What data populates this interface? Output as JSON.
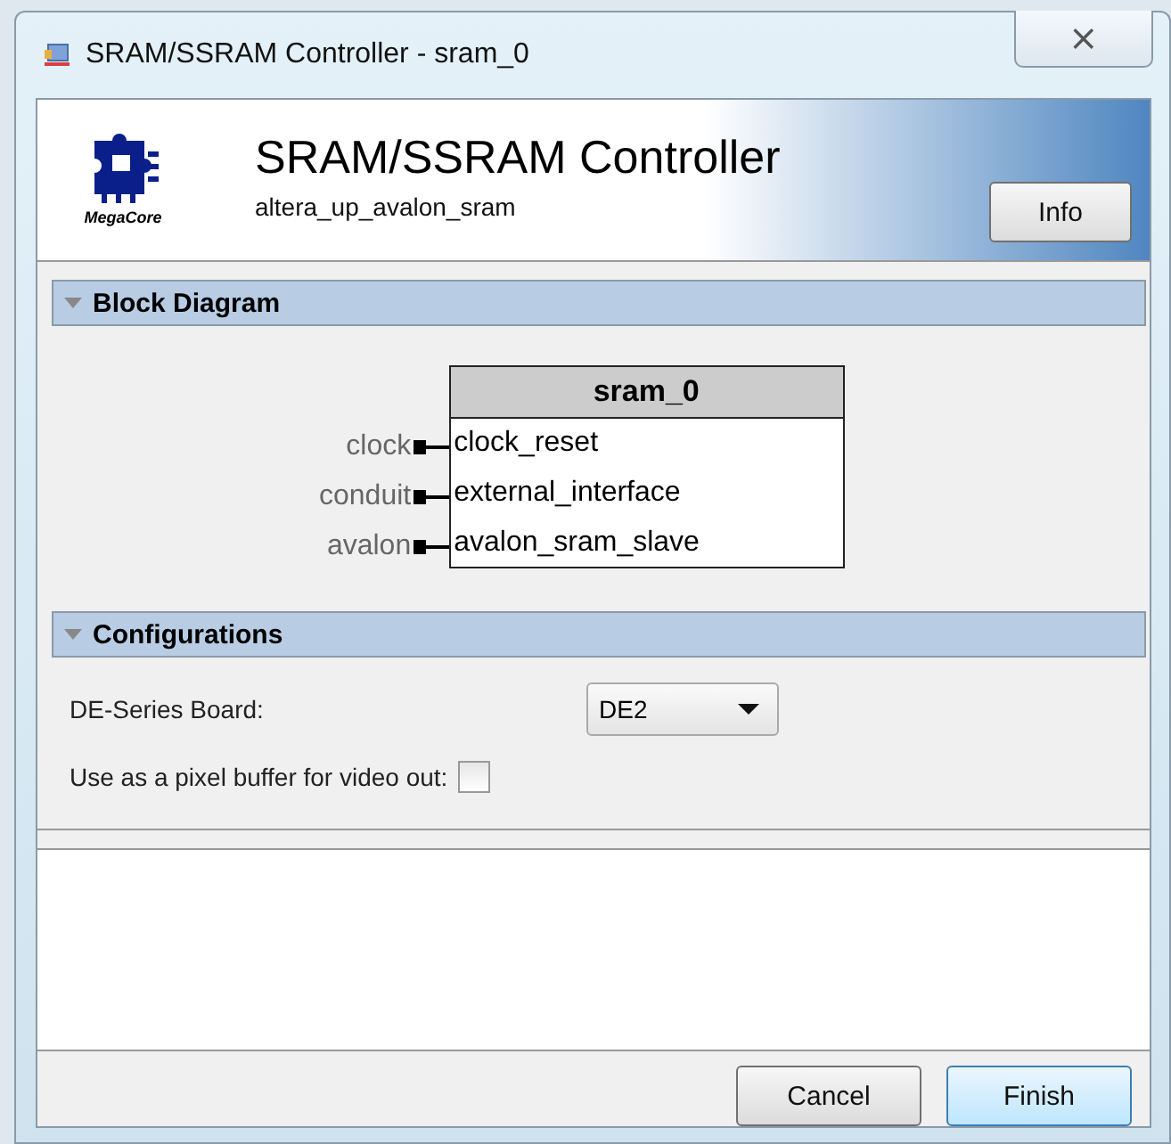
{
  "window": {
    "title": "SRAM/SSRAM Controller - sram_0",
    "close": "⨯"
  },
  "header": {
    "logo_text": "MegaCore",
    "title": "SRAM/SSRAM Controller",
    "subtitle": "altera_up_avalon_sram",
    "info_button": "Info"
  },
  "block_diagram": {
    "title": "Block Diagram",
    "expanded": true,
    "block_name": "sram_0",
    "ports": [
      {
        "external": "clock",
        "internal": "clock_reset"
      },
      {
        "external": "conduit",
        "internal": "external_interface"
      },
      {
        "external": "avalon",
        "internal": "avalon_sram_slave"
      }
    ]
  },
  "configurations": {
    "title": "Configurations",
    "expanded": true,
    "board": {
      "label": "DE-Series Board:",
      "value": "DE2"
    },
    "pixel_buffer": {
      "label": "Use as a pixel buffer for video out:",
      "checked": false
    }
  },
  "buttons": [
    {
      "label": "Cancel",
      "default": false
    },
    {
      "label": "Finish",
      "default": true
    }
  ]
}
